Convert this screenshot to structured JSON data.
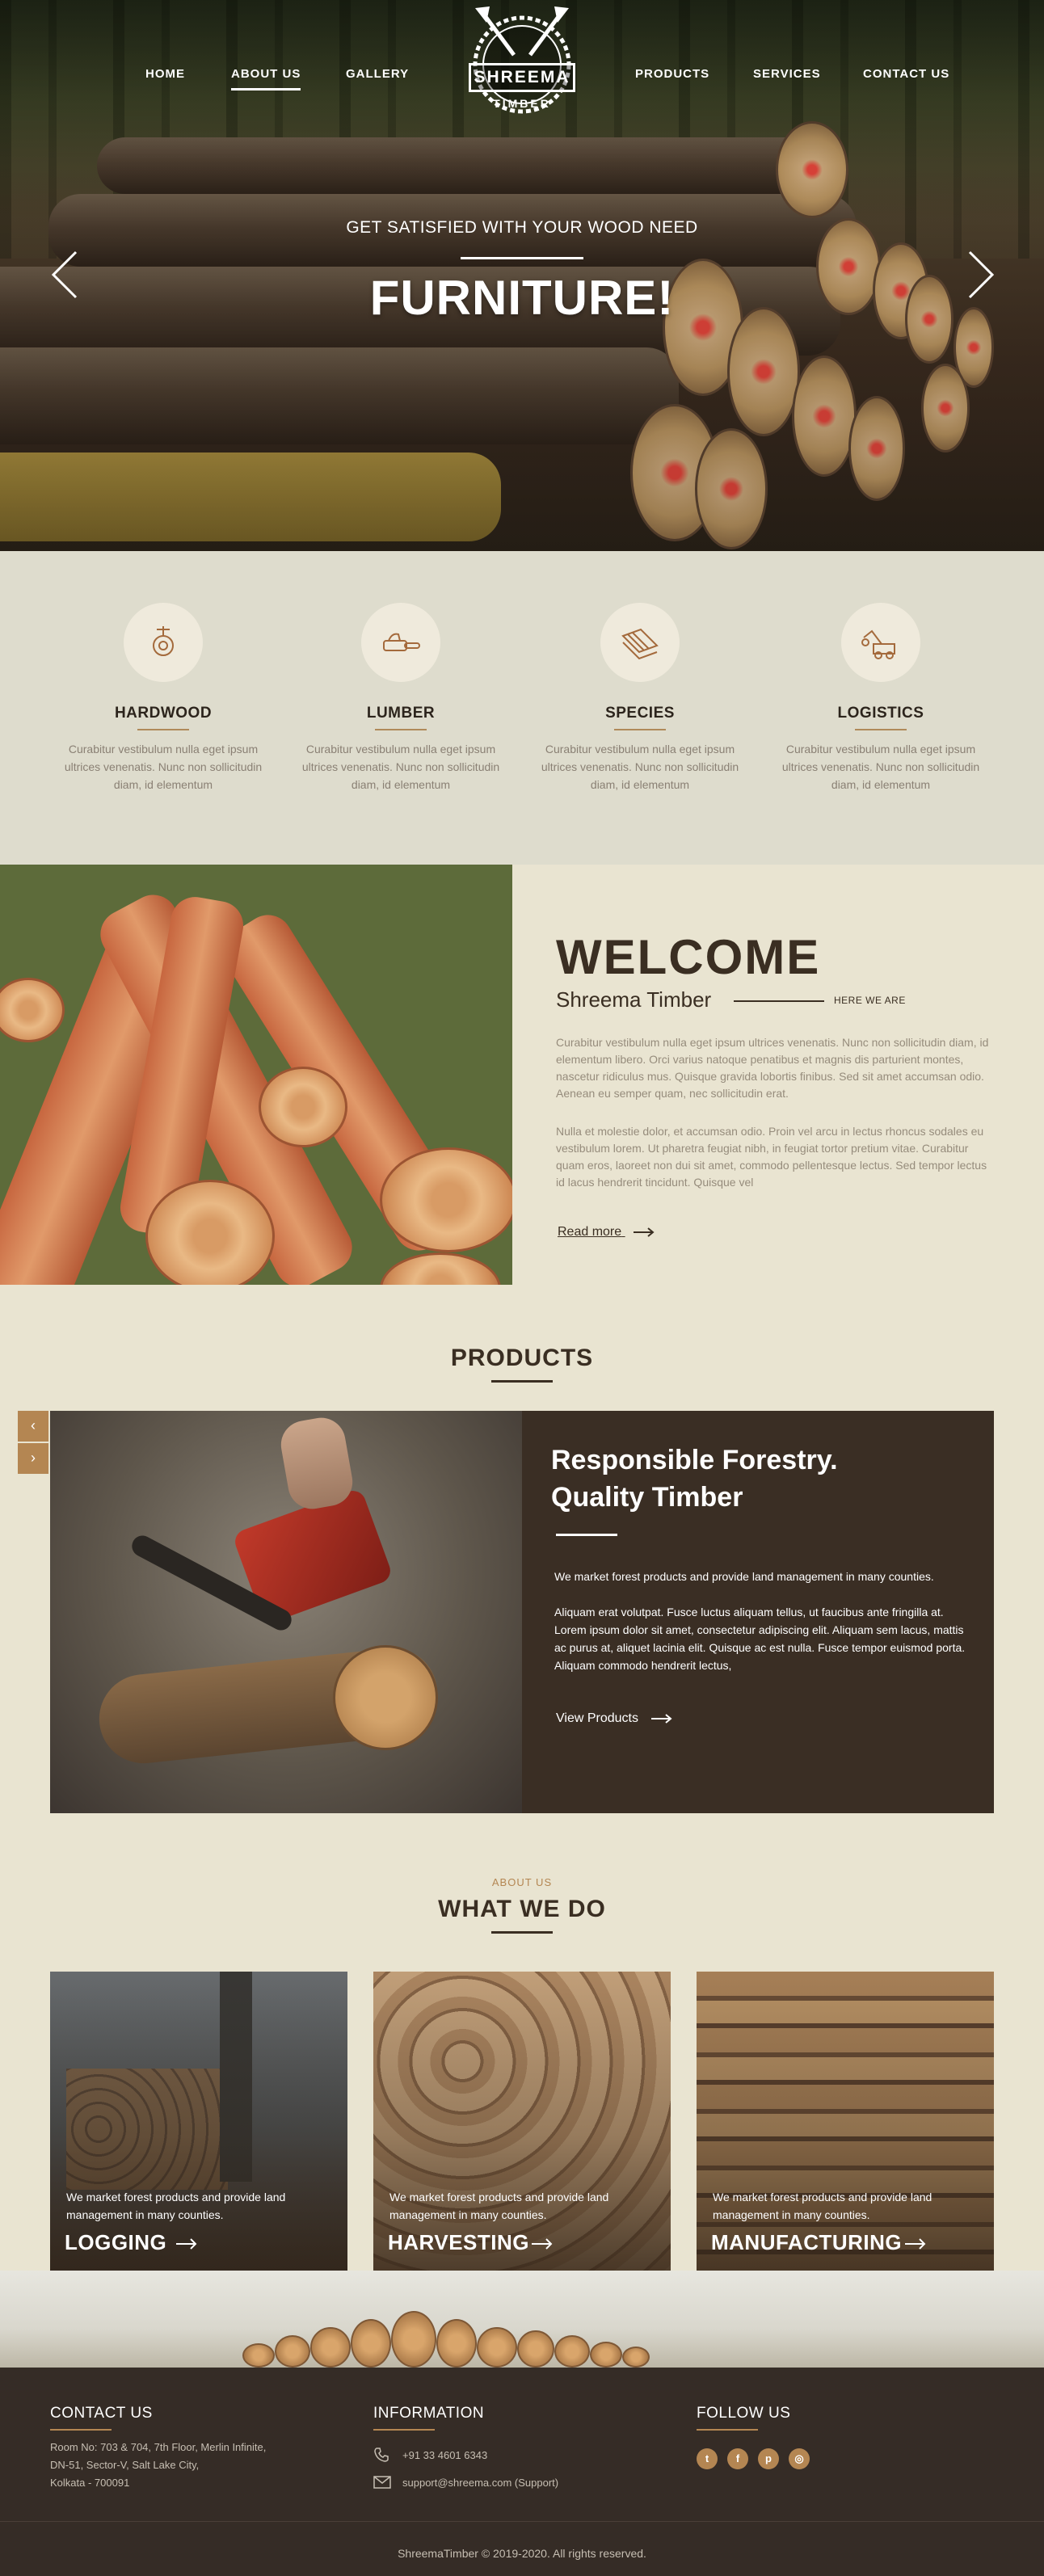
{
  "nav": {
    "home": "HOME",
    "about": "ABOUT US",
    "gallery": "GALLERY",
    "products": "PRODUCTS",
    "services": "SERVICES",
    "contact": "CONTACT US"
  },
  "logo": {
    "name": "SHREEMA",
    "sub": "TIMBER"
  },
  "hero": {
    "subtitle": "GET SATISFIED WITH YOUR WOOD NEED",
    "title": "FURNITURE!"
  },
  "features": [
    {
      "title": "HARDWOOD",
      "text": "Curabitur vestibulum nulla eget ipsum ultrices venenatis. Nunc non sollicitudin diam, id elementum",
      "icon": "hardwood-icon"
    },
    {
      "title": "LUMBER",
      "text": "Curabitur vestibulum nulla eget ipsum ultrices venenatis. Nunc non sollicitudin diam, id elementum",
      "icon": "chainsaw-icon"
    },
    {
      "title": "SPECIES",
      "text": "Curabitur vestibulum nulla eget ipsum ultrices venenatis. Nunc non sollicitudin diam, id elementum",
      "icon": "planks-icon"
    },
    {
      "title": "LOGISTICS",
      "text": "Curabitur vestibulum nulla eget ipsum ultrices venenatis. Nunc non sollicitudin diam, id elementum",
      "icon": "log-loader-icon"
    }
  ],
  "welcome": {
    "title": "WELCOME",
    "subtitle": "Shreema Timber",
    "tag": "HERE WE ARE",
    "p1": "Curabitur vestibulum nulla eget ipsum ultrices venenatis. Nunc non sollicitudin diam, id elementum libero. Orci varius natoque penatibus et magnis dis parturient montes, nascetur ridiculus mus. Quisque gravida lobortis finibus. Sed sit amet accumsan odio. Aenean eu semper quam, nec sollicitudin erat.",
    "p2": "Nulla et molestie dolor, et accumsan odio. Proin vel arcu in lectus rhoncus sodales eu vestibulum lorem. Ut pharetra feugiat nibh, in feugiat tortor pretium vitae. Curabitur quam eros, laoreet non dui sit amet, commodo pellentesque lectus. Sed tempor lectus id lacus hendrerit tincidunt. Quisque vel",
    "readmore": "Read more"
  },
  "products": {
    "section_title": "PRODUCTS",
    "heading_line1": "Responsible Forestry.",
    "heading_line2": "Quality Timber",
    "p1": "We market forest products and provide land management in many counties.",
    "p2": "Aliquam erat volutpat. Fusce luctus aliquam tellus, ut faucibus ante fringilla at. Lorem ipsum dolor sit amet, consectetur adipiscing elit. Aliquam sem lacus, mattis ac purus at, aliquet lacinia elit. Quisque ac est nulla. Fusce tempor euismod porta. Aliquam commodo hendrerit lectus,",
    "view": "View Products",
    "prev": "‹",
    "next": "›"
  },
  "whatwedo": {
    "tag": "ABOUT US",
    "title": "WHAT WE DO",
    "cards": [
      {
        "text": "We market forest products and provide land management in many counties.",
        "title": "LOGGING"
      },
      {
        "text": "We market forest products and provide land management in many counties.",
        "title": "HARVESTING"
      },
      {
        "text": "We market forest products and provide land management in many counties.",
        "title": "MANUFACTURING"
      }
    ]
  },
  "footer": {
    "contact_title": "CONTACT US",
    "address_1": "Room No: 703 & 704, 7th Floor, Merlin Infinite,",
    "address_2": "DN-51, Sector-V, Salt Lake City,",
    "address_3": "Kolkata - 700091",
    "info_title": "INFORMATION",
    "phone": "+91 33 4601 6343",
    "email": "support@shreema.com (Support)",
    "follow_title": "FOLLOW US",
    "social": [
      {
        "label": "t",
        "icon": "twitter-icon"
      },
      {
        "label": "f",
        "icon": "facebook-icon"
      },
      {
        "label": "p",
        "icon": "pinterest-icon"
      },
      {
        "label": "◎",
        "icon": "instagram-icon"
      }
    ],
    "copyright": "ShreemaTimber © 2019-2020. All rights reserved."
  },
  "colors": {
    "accent": "#b48652",
    "dark": "#3a2e24",
    "beige": "#e9e4d1",
    "feature_bg": "#dedccd"
  }
}
